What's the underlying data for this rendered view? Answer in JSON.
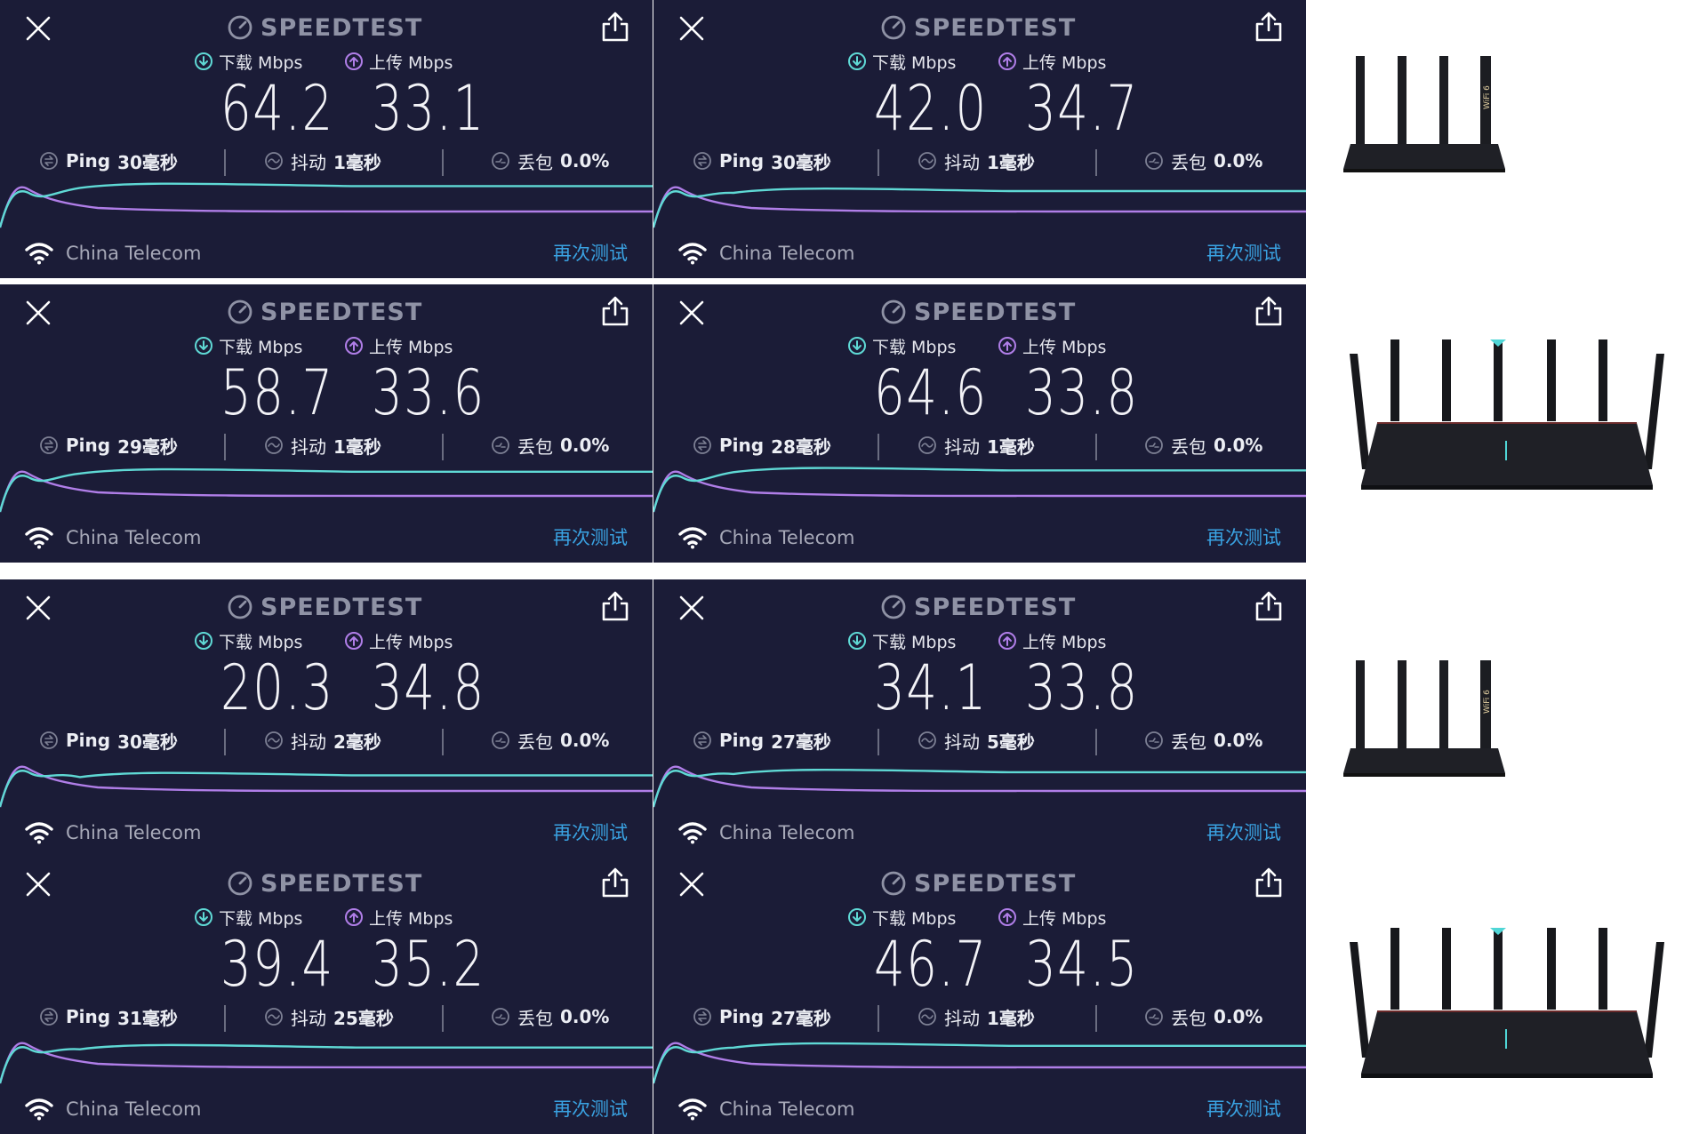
{
  "app": {
    "brand": "SPEEDTEST",
    "download_label": "下载 Mbps",
    "upload_label": "上传 Mbps",
    "ping_label": "Ping",
    "jitter_label": "抖动",
    "loss_label": "丢包",
    "isp": "China Telecom",
    "retry_label": "再次测试",
    "colors": {
      "panel_bg": "#1b1c37",
      "download": "#5fd9d5",
      "upload": "#b07ee8",
      "retry": "#3aa3e3"
    }
  },
  "groups": [
    {
      "rows": [
        {
          "tests": [
            {
              "download": "64.2",
              "upload": "33.1",
              "ping": "30毫秒",
              "jitter": "1毫秒",
              "loss": "0.0%"
            },
            {
              "download": "42.0",
              "upload": "34.7",
              "ping": "30毫秒",
              "jitter": "1毫秒",
              "loss": "0.0%"
            }
          ]
        },
        {
          "tests": [
            {
              "download": "58.7",
              "upload": "33.6",
              "ping": "29毫秒",
              "jitter": "1毫秒",
              "loss": "0.0%"
            },
            {
              "download": "64.6",
              "upload": "33.8",
              "ping": "28毫秒",
              "jitter": "1毫秒",
              "loss": "0.0%"
            }
          ]
        }
      ]
    },
    {
      "rows": [
        {
          "tests": [
            {
              "download": "20.3",
              "upload": "34.8",
              "ping": "30毫秒",
              "jitter": "2毫秒",
              "loss": "0.0%"
            },
            {
              "download": "34.1",
              "upload": "33.8",
              "ping": "27毫秒",
              "jitter": "5毫秒",
              "loss": "0.0%"
            }
          ]
        },
        {
          "tests": [
            {
              "download": "39.4",
              "upload": "35.2",
              "ping": "31毫秒",
              "jitter": "25毫秒",
              "loss": "0.0%"
            },
            {
              "download": "46.7",
              "upload": "34.5",
              "ping": "27毫秒",
              "jitter": "1毫秒",
              "loss": "0.0%"
            }
          ]
        }
      ]
    }
  ],
  "router_badge": "WiFi 6"
}
